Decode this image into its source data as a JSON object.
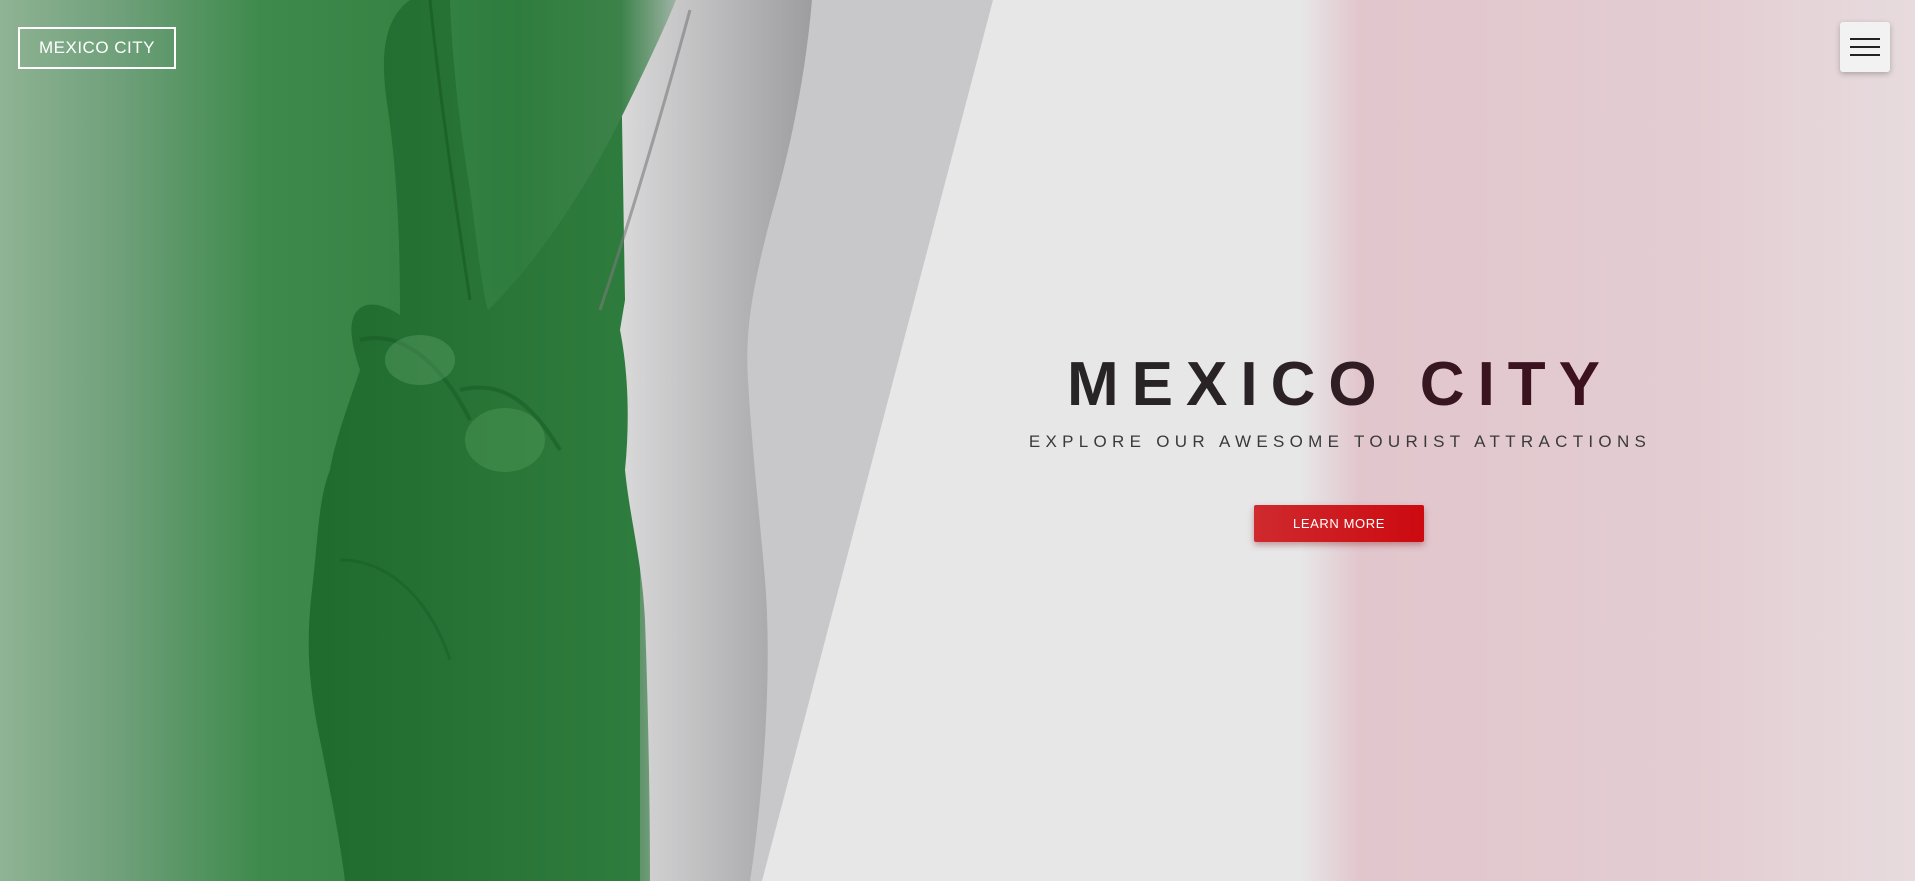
{
  "header": {
    "logo_text": "MEXICO CITY",
    "menu_icon": "hamburger-icon"
  },
  "hero": {
    "title": "MEXICO CITY",
    "subtitle": "EXPLORE OUR AWESOME TOURIST ATTRACTIONS",
    "cta_label": "LEARN MORE",
    "image": "peace-sign-hand-mexico-flag-image"
  },
  "colors": {
    "flag_green": "#2f7d3e",
    "flag_white": "#c8c8ca",
    "flag_red_tint": "#e3c8cf",
    "cta_red": "#cc0a10",
    "title_text": "#262626",
    "background": "#e7e7e8"
  }
}
